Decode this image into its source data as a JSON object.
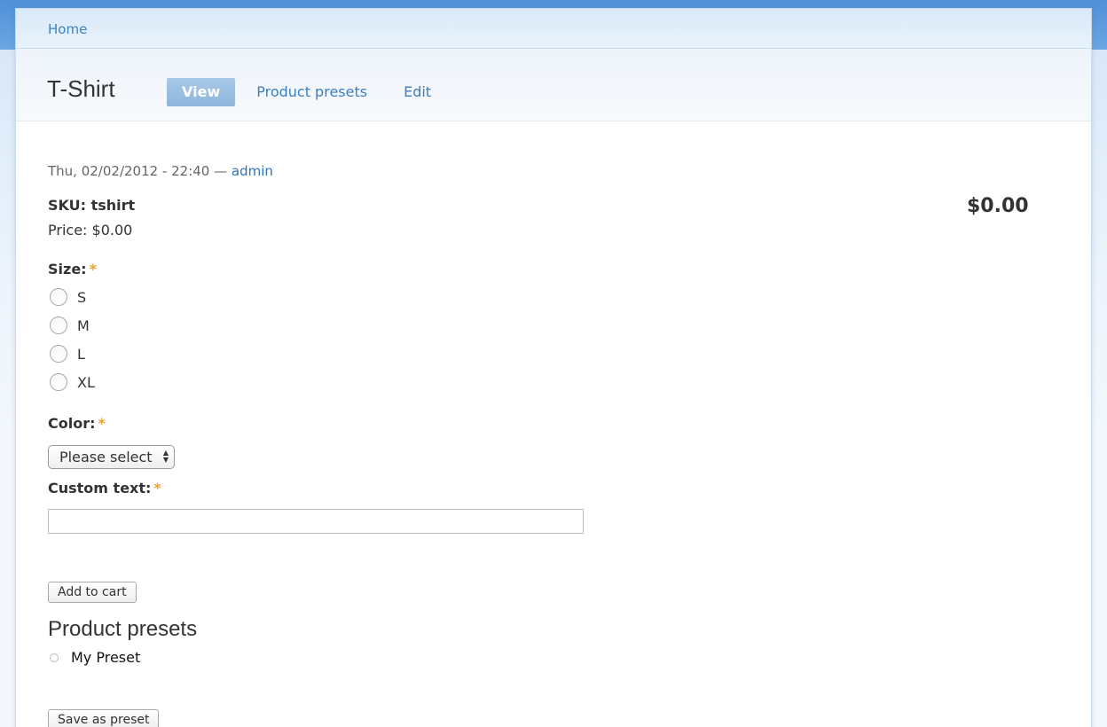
{
  "breadcrumb": {
    "home": "Home"
  },
  "page": {
    "title": "T-Shirt"
  },
  "tabs": [
    {
      "label": "View",
      "active": true
    },
    {
      "label": "Product presets",
      "active": false
    },
    {
      "label": "Edit",
      "active": false
    }
  ],
  "node": {
    "submitted": "Thu, 02/02/2012 - 22:40",
    "separator": "—",
    "author": "admin"
  },
  "product": {
    "sku": "SKU: tshirt",
    "price_label": "Price: $0.00",
    "display_price": "$0.00"
  },
  "form": {
    "size": {
      "label": "Size:",
      "required_mark": "*",
      "options": [
        "S",
        "M",
        "L",
        "XL"
      ]
    },
    "color": {
      "label": "Color:",
      "required_mark": "*",
      "selected": "Please select"
    },
    "custom_text": {
      "label": "Custom text:",
      "required_mark": "*",
      "value": ""
    },
    "add_to_cart": "Add to cart"
  },
  "presets": {
    "heading": "Product presets",
    "items": [
      "My Preset"
    ],
    "save_button": "Save as preset"
  },
  "colors": {
    "accent": "#3b7fc0",
    "required": "#f0a030",
    "topbar": "#4f90d8"
  }
}
